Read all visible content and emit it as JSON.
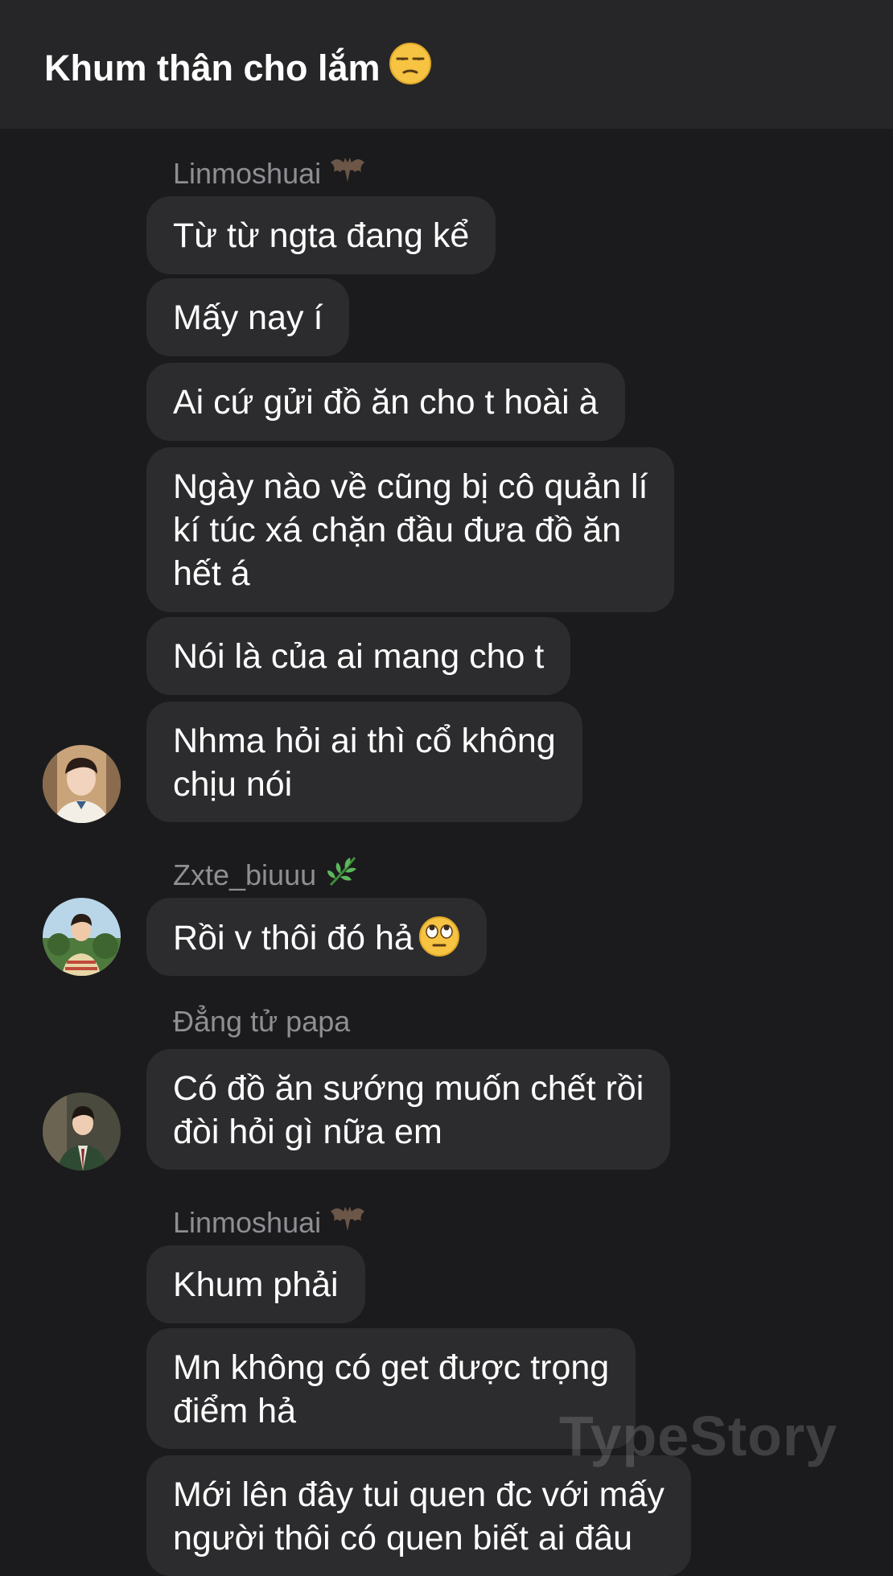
{
  "header": {
    "title": "Khum thân cho lắm",
    "title_emoji": "unamused-face-icon"
  },
  "messages": [
    {
      "sender": "Linmoshuai",
      "sender_icon": "bat-icon",
      "avatar": "avatar-linmoshuai",
      "bubbles": [
        "Từ từ ngta đang kể",
        "Mấy nay í",
        "Ai cứ gửi đồ ăn cho t hoài à",
        "Ngày nào về cũng bị cô quản lí",
        "kí túc xá chặn đầu đưa đồ ăn",
        "hết á",
        "Nói là của ai mang cho t",
        "Nhma hỏi ai thì cổ không",
        "chịu nói"
      ]
    },
    {
      "sender": "Zxte_biuuu",
      "sender_icon": "herb-icon",
      "avatar": "avatar-zxte",
      "bubbles": [
        "Rồi v thôi đó hả"
      ],
      "bubble_emoji": "eye-roll-face-icon"
    },
    {
      "sender": "Đẳng tử papa",
      "avatar": "avatar-dang-tu-papa",
      "bubbles": [
        "Có đồ ăn sướng muốn chết rồi",
        "đòi hỏi gì nữa em"
      ]
    },
    {
      "sender": "Linmoshuai",
      "sender_icon": "bat-icon",
      "bubbles": [
        "Khum phải",
        "Mn không có get được trọng",
        "điểm hả",
        "Mới lên đây tui quen đc với mấy",
        "người thôi có quen biết ai đâu"
      ]
    }
  ],
  "watermark": "TypeStory",
  "colors": {
    "background": "#1b1b1d",
    "header": "#262628",
    "bubble": "#2c2c2e",
    "sender_name": "#8e8e93",
    "text": "#ffffff"
  }
}
